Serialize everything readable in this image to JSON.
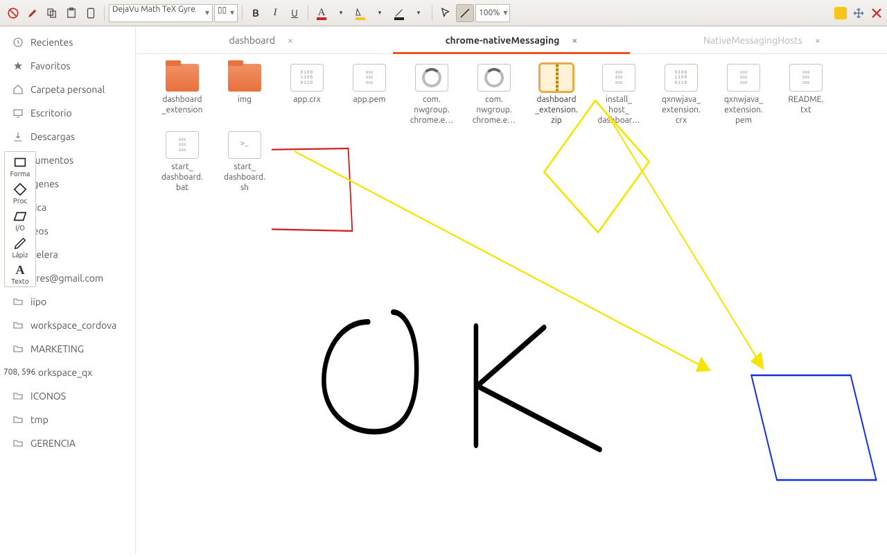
{
  "toolbar": {
    "font": "DejaVu Math TeX Gyre",
    "zoom": "100%",
    "colors": {
      "text": "#cc2222",
      "highlight": "#f5c518",
      "line": "#222222"
    }
  },
  "palette": [
    {
      "label": "Forma",
      "icon": "square"
    },
    {
      "label": "Proc",
      "icon": "diamond"
    },
    {
      "label": "I/O",
      "icon": "parallelogram"
    },
    {
      "label": "Lápiz",
      "icon": "pencil"
    },
    {
      "label": "Texto",
      "icon": "text"
    }
  ],
  "coord": "708, 596",
  "sidebar": [
    {
      "label": "Recientes",
      "icon": "clock"
    },
    {
      "label": "Favoritos",
      "icon": "star"
    },
    {
      "label": "Carpeta personal",
      "icon": "home"
    },
    {
      "label": "Escritorio",
      "icon": "desktop"
    },
    {
      "label": "Descargas",
      "icon": "download"
    },
    {
      "label": "cumentos",
      "icon": "folder"
    },
    {
      "label": "igenes",
      "icon": "folder"
    },
    {
      "label": "sica",
      "icon": "folder"
    },
    {
      "label": "leos",
      "icon": "folder"
    },
    {
      "label": "pelera",
      "icon": "trash"
    },
    {
      "label": "dres@gmail.com",
      "icon": "folder"
    },
    {
      "label": "iipo",
      "icon": "folder"
    },
    {
      "label": "workspace_cordova",
      "icon": "folder"
    },
    {
      "label": "MARKETING",
      "icon": "folder"
    },
    {
      "label": "workspace_qx",
      "icon": "folder"
    },
    {
      "label": "ICONOS",
      "icon": "folder"
    },
    {
      "label": "tmp",
      "icon": "folder"
    },
    {
      "label": "GERENCIA",
      "icon": "folder"
    }
  ],
  "tabs": [
    {
      "label": "dashboard",
      "active": false
    },
    {
      "label": "chrome-nativeMessaging",
      "active": true
    },
    {
      "label": "NativeMessagingHosts",
      "active": false,
      "dim": true
    }
  ],
  "files": [
    {
      "label": "dashboard\n_extension",
      "type": "folder"
    },
    {
      "label": "img",
      "type": "folder"
    },
    {
      "label": "app.crx",
      "type": "bin"
    },
    {
      "label": "app.pem",
      "type": "text"
    },
    {
      "label": "com.\nnwgroup.\nchrome.e…",
      "type": "spin"
    },
    {
      "label": "com.\nnwgroup.\nchrome.e…",
      "type": "spin"
    },
    {
      "label": "dashboard\n_extension.\nzip",
      "type": "zip",
      "sel": true
    },
    {
      "label": "install_\nhost_\ndashboar…",
      "type": "text"
    },
    {
      "label": "qxnwjava_\nextension.\ncrx",
      "type": "bin"
    },
    {
      "label": "qxnwjava_\nextension.\npem",
      "type": "text"
    },
    {
      "label": "README.\ntxt",
      "type": "text"
    },
    {
      "label": "start_\ndashboard.\nbat",
      "type": "text"
    },
    {
      "label": "start_\ndashboard.\nsh",
      "type": "sh"
    }
  ],
  "annotations": {
    "handwritten_text": "OK",
    "shapes": [
      "red-rectangle",
      "yellow-diamond",
      "blue-parallelogram"
    ],
    "arrows": 2
  }
}
